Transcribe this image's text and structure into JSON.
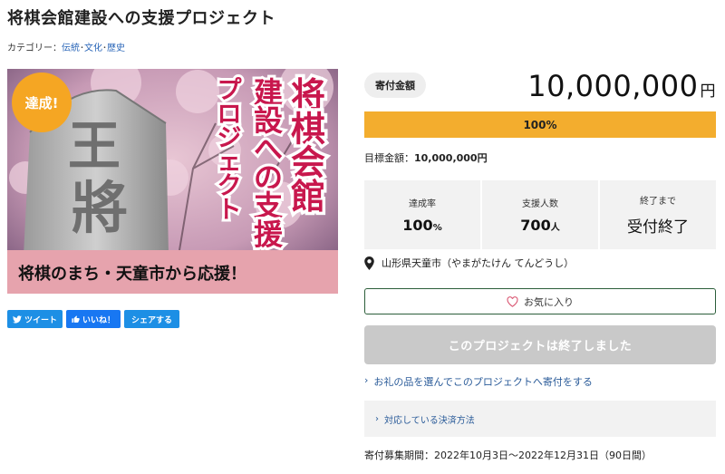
{
  "page": {
    "title": "将棋会館建設への支援プロジェクト",
    "category_label": "カテゴリー：",
    "categories": [
      "伝統",
      "文化",
      "歴史"
    ]
  },
  "hero": {
    "badge": "達成!",
    "headline_lines": [
      "将棋会館",
      "建設への支援",
      "プロジェクト"
    ],
    "banner": "将棋のまち・天童市から応援！",
    "stone_chars": [
      "王",
      "將"
    ]
  },
  "share": {
    "tweet": "ツイート",
    "like": "いいね！",
    "share": "シェアする"
  },
  "funding": {
    "amount_label": "寄付金額",
    "amount": "10,000,000",
    "amount_unit": "円",
    "progress_text": "100%",
    "progress_fraction": 1.0,
    "goal_label": "目標金額：",
    "goal_value": "10,000,000円"
  },
  "stats": [
    {
      "label": "達成率",
      "value": "100",
      "unit": "%"
    },
    {
      "label": "支援人数",
      "value": "700",
      "unit": "人"
    },
    {
      "label": "終了まで",
      "value": "受付終了",
      "unit": ""
    }
  ],
  "location": "山形県天童市（やまがたけん てんどうし）",
  "favorite_label": "お気に入り",
  "ended_label": "このプロジェクトは終了しました",
  "gift_link": "お礼の品を選んでこのプロジェクトへ寄付をする",
  "payment_link": "対応している決済方法",
  "period": "寄付募集期間：2022年10月3日～2022年12月31日（90日間）",
  "colors": {
    "progress": "#f3ad2e",
    "badge": "#f5a623",
    "headline_red": "#c8174d",
    "banner_pink": "#e6a3ad",
    "link": "#2a5b99",
    "twitter": "#1d8fe5",
    "facebook": "#1877f2",
    "favorite_border": "#2c5e3a",
    "ended_button": "#c9c9c9"
  },
  "icons": {
    "twitter": "twitter-bird-icon",
    "like": "thumbs-up-icon",
    "location": "map-pin-icon",
    "favorite": "heart-icon",
    "chevron": "chevron-right-icon"
  }
}
